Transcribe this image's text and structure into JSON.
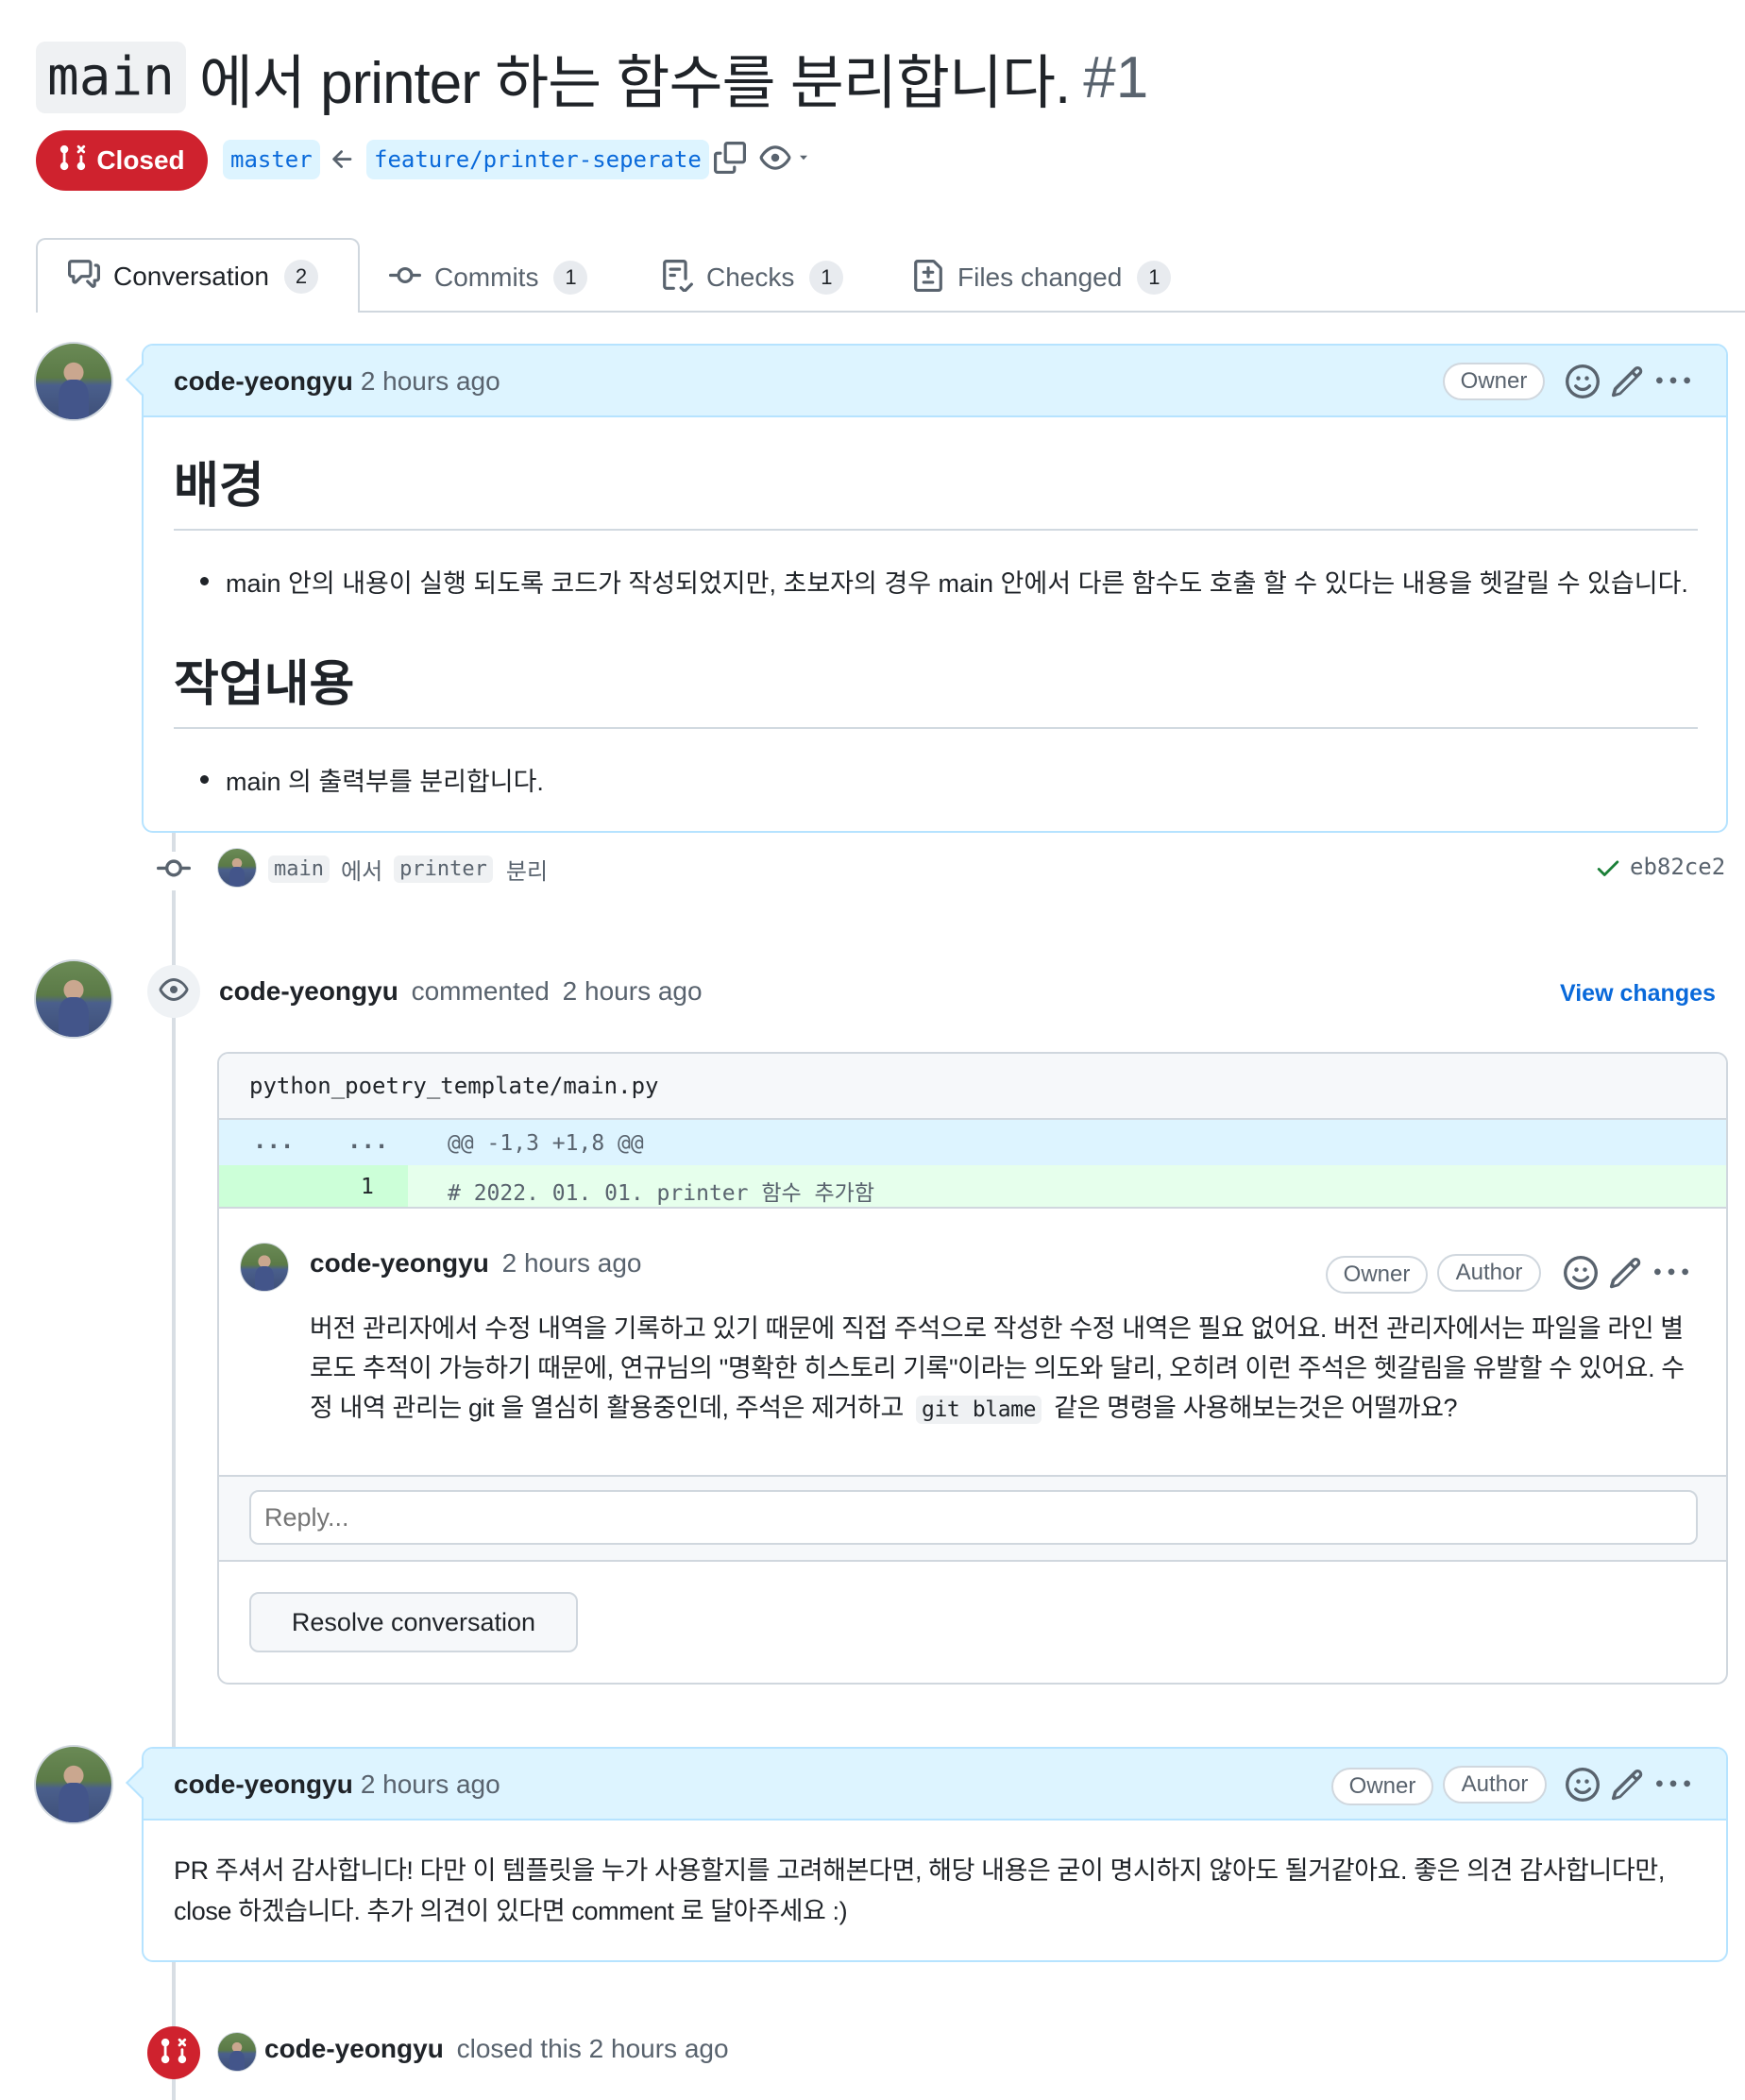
{
  "pr": {
    "title_code": "main",
    "title_text": "에서 printer 하는 함수를 분리합니다.",
    "number": "#1",
    "state": "Closed",
    "base_branch": "master",
    "head_branch": "feature/printer-seperate"
  },
  "tabs": [
    {
      "label": "Conversation",
      "count": "2"
    },
    {
      "label": "Commits",
      "count": "1"
    },
    {
      "label": "Checks",
      "count": "1"
    },
    {
      "label": "Files changed",
      "count": "1"
    }
  ],
  "first_comment": {
    "author": "code-yeongyu",
    "time": "2 hours ago",
    "badge_owner": "Owner",
    "h1": "배경",
    "bullet1": "main 안의 내용이 실행 되도록 코드가 작성되었지만, 초보자의 경우 main 안에서 다른 함수도 호출 할 수 있다는 내용을 헷갈릴 수 있습니다.",
    "h2": "작업내용",
    "bullet2": "main 의 출력부를 분리합니다."
  },
  "commit": {
    "code1": "main",
    "text1": "에서",
    "code2": "printer",
    "text2": "분리",
    "sha": "eb82ce2"
  },
  "review": {
    "author": "code-yeongyu",
    "action": "commented",
    "time": "2 hours ago",
    "view_changes": "View changes",
    "file_path": "python_poetry_template/main.py",
    "hunk_left": "...",
    "hunk_right": "...",
    "hunk_header": "@@ -1,3 +1,8 @@",
    "line_number": "1",
    "line_code": "# 2022. 01. 01. printer 함수 추가함",
    "comment": {
      "author": "code-yeongyu",
      "time": "2 hours ago",
      "badge_owner": "Owner",
      "badge_author": "Author",
      "body_line1": "버전 관리자에서 수정 내역을 기록하고 있기 때문에 직접 주석으로 작성한 수정 내역은 필요 없어요. 버전 관리자에서는 파일을 라인 별",
      "body_line2": "로도 추적이 가능하기 때문에, 연규님의 \"명확한 히스토리 기록\"이라는 의도와 달리, 오히려 이런 주석은 헷갈림을 유발할 수 있어요. 수",
      "body_line3a": "정 내역 관리는 git 을 열심히 활용중인데, 주석은 제거하고",
      "body_code": "git blame",
      "body_line3b": "같은 명령을 사용해보는것은 어떨까요?"
    },
    "reply_placeholder": "Reply...",
    "resolve_label": "Resolve conversation"
  },
  "second_comment": {
    "author": "code-yeongyu",
    "time": "2 hours ago",
    "badge_owner": "Owner",
    "badge_author": "Author",
    "body_line1": "PR 주셔서 감사합니다! 다만 이 템플릿을 누가 사용할지를 고려해본다면, 해당 내용은 굳이 명시하지 않아도 될거같아요. 좋은 의견 감사합니다만,",
    "body_line2": "close 하겠습니다. 추가 의견이 있다면 comment 로 달아주세요 :)"
  },
  "closed_event": {
    "author": "code-yeongyu",
    "text": "closed this 2 hours ago"
  },
  "colors": {
    "closed_red": "#cf222e",
    "link_blue": "#0969da",
    "header_blue_bg": "#ddf4ff",
    "header_blue_border": "#b6e3ff",
    "diff_add_bg": "#e6ffec",
    "diff_add_num_bg": "#ccffd8",
    "hunk_bg": "#ddf4ff",
    "check_green": "#1a7f37"
  }
}
